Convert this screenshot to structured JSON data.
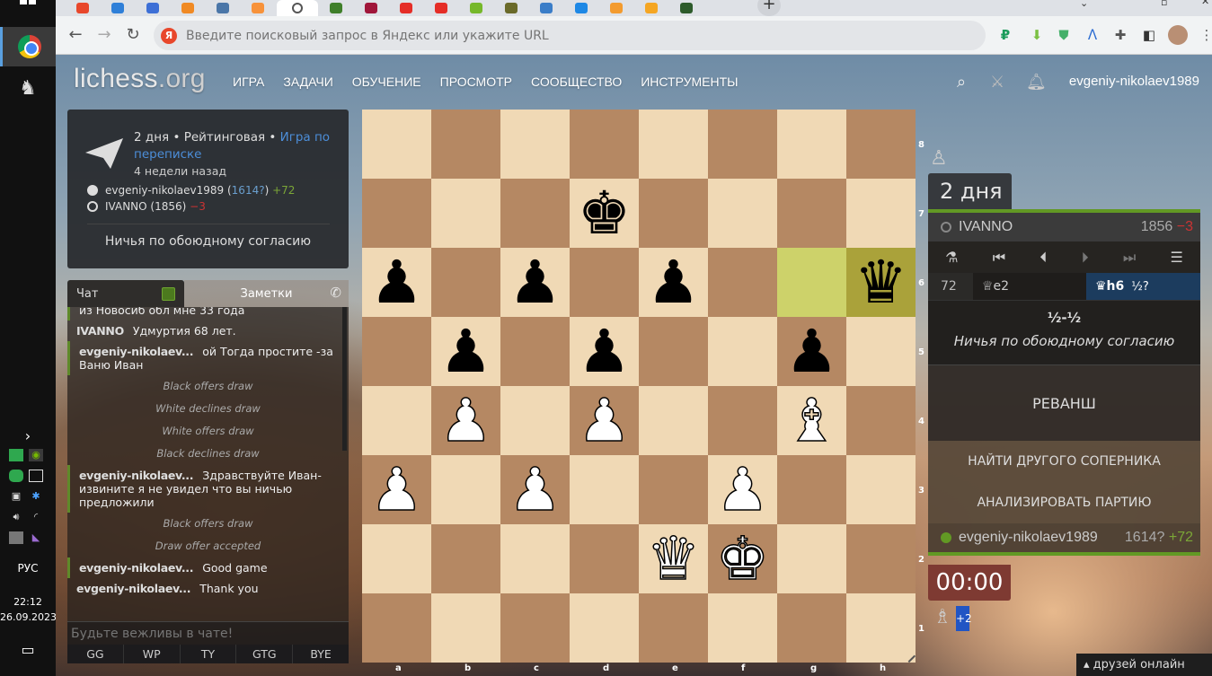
{
  "taskbar": {
    "language": "РУС",
    "time": "22:12",
    "date": "26.09.2023",
    "apps": [
      "windows-start",
      "chrome",
      "chess-app"
    ]
  },
  "browser": {
    "tabs": [
      {
        "name": "yandex",
        "color": "#e8472b"
      },
      {
        "name": "edge-like",
        "color": "#2f7fd8"
      },
      {
        "name": "mail",
        "color": "#3d6fd6"
      },
      {
        "name": "odnoklassniki",
        "color": "#f08a24"
      },
      {
        "name": "vk",
        "color": "#4a76a8"
      },
      {
        "name": "orange-app",
        "color": "#f7923a"
      },
      {
        "name": "lichess",
        "color": "#ffffff",
        "active": true
      },
      {
        "name": "chess-green",
        "color": "#3f7f2a"
      },
      {
        "name": "k-app",
        "color": "#a0163a"
      },
      {
        "name": "youtube",
        "color": "#e52d27"
      },
      {
        "name": "youtube-2",
        "color": "#e52d27"
      },
      {
        "name": "green-i",
        "color": "#76b82a"
      },
      {
        "name": "shield",
        "color": "#6a6a2a"
      },
      {
        "name": "chart",
        "color": "#3a7dc8"
      },
      {
        "name": "p-app",
        "color": "#1e88e5"
      },
      {
        "name": "d-app",
        "color": "#f39b2f"
      },
      {
        "name": "q-app",
        "color": "#f5a623"
      },
      {
        "name": "chess-dark",
        "color": "#2d5b2b"
      }
    ],
    "newtab_label": "+",
    "omnibox": {
      "placeholder": "Введите поисковый запрос в Яндекс или укажите URL",
      "badge": "Я"
    }
  },
  "site": {
    "logo": "lichess",
    "logo_tld": ".org",
    "nav": [
      "ИГРА",
      "ЗАДАЧИ",
      "ОБУЧЕНИЕ",
      "ПРОСМОТР",
      "СООБЩЕСТВО",
      "ИНСТРУМЕНТЫ"
    ],
    "username": "evgeniy-nikolaev1989"
  },
  "game_info": {
    "time_control": "2 дня • Рейтинговая • ",
    "variant_link": "Игра по переписке",
    "ago": "4 недели назад",
    "white": {
      "name": "evgeniy-nikolaev1989",
      "rating": "1614?",
      "diff": "+72"
    },
    "black": {
      "name": "IVANNO",
      "rating": "1856",
      "diff": "−3"
    },
    "status": "Ничья по обоюдному согласию"
  },
  "chat": {
    "tab_chat": "Чат",
    "tab_notes": "Заметки",
    "messages": [
      {
        "type": "user",
        "self": true,
        "user": "",
        "text": "из Новосиб обл мне 33 года"
      },
      {
        "type": "user",
        "self": false,
        "user": "IVANNO",
        "text": "Удмуртия 68 лет."
      },
      {
        "type": "user",
        "self": true,
        "user": "evgeniy-nikolaev...",
        "text": "ой Тогда простите -за Ваню Иван"
      },
      {
        "type": "system",
        "text": "Black offers draw"
      },
      {
        "type": "system",
        "text": "White declines draw"
      },
      {
        "type": "system",
        "text": "White offers draw"
      },
      {
        "type": "system",
        "text": "Black declines draw"
      },
      {
        "type": "user",
        "self": true,
        "user": "evgeniy-nikolaev...",
        "text": "Здравствуйте Иван-извините я не увидел что вы ничью предложили"
      },
      {
        "type": "system",
        "text": "Black offers draw"
      },
      {
        "type": "system",
        "text": "Draw offer accepted"
      },
      {
        "type": "user",
        "self": true,
        "user": "evgeniy-nikolaev...",
        "text": "Good game"
      },
      {
        "type": "user",
        "self": false,
        "user": "evgeniy-nikolaev...",
        "text": "Thank you"
      }
    ],
    "input_placeholder": "Будьте вежливы в чате!",
    "presets": [
      "GG",
      "WP",
      "TY",
      "GTG",
      "BYE"
    ]
  },
  "board": {
    "files": [
      "a",
      "b",
      "c",
      "d",
      "e",
      "f",
      "g",
      "h"
    ],
    "ranks": [
      "8",
      "7",
      "6",
      "5",
      "4",
      "3",
      "2",
      "1"
    ],
    "highlight_squares": [
      "g6",
      "h6"
    ],
    "pieces": {
      "d7": "bK",
      "a6": "bP",
      "c6": "bP",
      "e6": "bP",
      "h6": "bQ",
      "b5": "bP",
      "d5": "bP",
      "g5": "bP",
      "b4": "wP",
      "d4": "wP",
      "g4": "wB",
      "a3": "wP",
      "c3": "wP",
      "f3": "wP",
      "e2": "wQ",
      "f2": "wK"
    }
  },
  "right_panel": {
    "clock_top": "2 дня",
    "clock_bottom": "00:00",
    "top_player": {
      "name": "IVANNO",
      "rating": "1856",
      "diff": "−3"
    },
    "bottom_player": {
      "name": "evgeniy-nikolaev1989",
      "rating": "1614?",
      "diff": "+72"
    },
    "controls": [
      "analysis",
      "first",
      "prev",
      "next",
      "last",
      "menu"
    ],
    "move_number": "72",
    "white_move": "♕e2",
    "black_move": "♛h6",
    "black_move_annotation": "½?",
    "score": "½-½",
    "result_text": "Ничья по обоюдному согласию",
    "rematch": "РЕВАНШ",
    "new_opponent": "НАЙТИ ДРУГОГО СОПЕРНИКА",
    "analyze": "АНАЛИЗИРОВАТЬ ПАРТИЮ",
    "material_advantage": "+2",
    "friends_online": "друзей онлайн"
  }
}
